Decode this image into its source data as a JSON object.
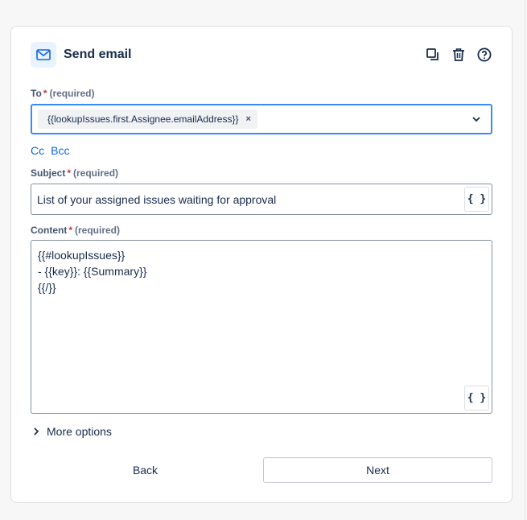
{
  "header": {
    "title": "Send email",
    "icons": [
      "mail-icon",
      "duplicate-icon",
      "trash-icon",
      "help-icon"
    ]
  },
  "to": {
    "label": "To",
    "required_mark": "*",
    "required_text": "(required)",
    "chip": "{{lookupIssues.first.Assignee.emailAddress}}",
    "chip_remove": "×"
  },
  "cc_label": "Cc",
  "bcc_label": "Bcc",
  "subject": {
    "label": "Subject",
    "required_mark": "*",
    "required_text": "(required)",
    "value": "List of your assigned issues waiting for approval",
    "smart_value_button": "{ }"
  },
  "content": {
    "label": "Content",
    "required_mark": "*",
    "required_text": "(required)",
    "lines": [
      "{{#lookupIssues}}",
      "- {{key}}: {{Summary}}",
      "{{/}}"
    ],
    "smart_value_button": "{ }"
  },
  "more_options": "More options",
  "buttons": {
    "back": "Back",
    "next": "Next"
  },
  "colors": {
    "accent": "#388bff",
    "link": "#0c66e4",
    "required": "#c9372c",
    "icon_badge_bg": "#e9f2ff"
  }
}
